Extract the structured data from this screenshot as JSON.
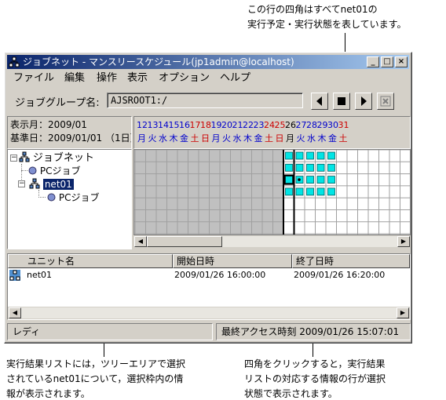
{
  "annotations": {
    "top_right": [
      "この行の四角はすべてnet01の",
      "実行予定・実行状態を表しています。"
    ],
    "bottom_left": [
      "実行結果リストには，ツリーエリアで選択",
      "されているnet01について，選択枠内の情",
      "報が表示されます。"
    ],
    "bottom_right": [
      "四角をクリックすると，実行結果",
      "リストの対応する情報の行が選択",
      "状態で表示されます。"
    ]
  },
  "window": {
    "title": "ジョブネット - マンスリースケジュール(jp1admin@localhost)",
    "buttons": {
      "minimize": "_",
      "maximize": "□",
      "close": "×"
    }
  },
  "menu": [
    "ファイル",
    "編集",
    "操作",
    "表示",
    "オプション",
    "ヘルプ"
  ],
  "group": {
    "label": "ジョブグループ名:",
    "value": "AJSROOT1:/"
  },
  "info": {
    "display_month": "表示月：2009/01",
    "base_day": "基準日：2009/01/01 （1日）"
  },
  "tree": {
    "root": "ジョブネット",
    "child1": "PCジョブ",
    "selected": "net01",
    "grandchild": "PCジョブ"
  },
  "calendar": {
    "days": [
      {
        "d": "12",
        "w": "月",
        "c": "#0000cc"
      },
      {
        "d": "13",
        "w": "火",
        "c": "#0000cc"
      },
      {
        "d": "14",
        "w": "水",
        "c": "#0000cc"
      },
      {
        "d": "15",
        "w": "木",
        "c": "#0000cc"
      },
      {
        "d": "16",
        "w": "金",
        "c": "#0000cc"
      },
      {
        "d": "17",
        "w": "土",
        "c": "#cc0000"
      },
      {
        "d": "18",
        "w": "日",
        "c": "#cc0000"
      },
      {
        "d": "19",
        "w": "月",
        "c": "#0000cc"
      },
      {
        "d": "20",
        "w": "火",
        "c": "#0000cc"
      },
      {
        "d": "21",
        "w": "水",
        "c": "#0000cc"
      },
      {
        "d": "22",
        "w": "木",
        "c": "#0000cc"
      },
      {
        "d": "23",
        "w": "金",
        "c": "#0000cc"
      },
      {
        "d": "24",
        "w": "土",
        "c": "#cc0000"
      },
      {
        "d": "25",
        "w": "日",
        "c": "#cc0000"
      },
      {
        "d": "26",
        "w": "月",
        "c": "#000000"
      },
      {
        "d": "27",
        "w": "火",
        "c": "#0000cc"
      },
      {
        "d": "28",
        "w": "水",
        "c": "#0000cc"
      },
      {
        "d": "29",
        "w": "木",
        "c": "#0000cc"
      },
      {
        "d": "30",
        "w": "金",
        "c": "#0000cc"
      },
      {
        "d": "31",
        "w": "土",
        "c": "#cc0000"
      }
    ],
    "colors": {
      "cell_fill": "#00e5e5",
      "grid_bg": "#c0c0c0",
      "white_area": "#ffffff"
    }
  },
  "result_list": {
    "columns": [
      "ユニット名",
      "開始日時",
      "終了日時"
    ],
    "rows": [
      {
        "unit": "net01",
        "start": "2009/01/26 16:00:00",
        "end": "2009/01/26 16:20:00"
      }
    ]
  },
  "status": {
    "left": "レディ",
    "right": "最終アクセス時刻 2009/01/26 15:07:01"
  }
}
